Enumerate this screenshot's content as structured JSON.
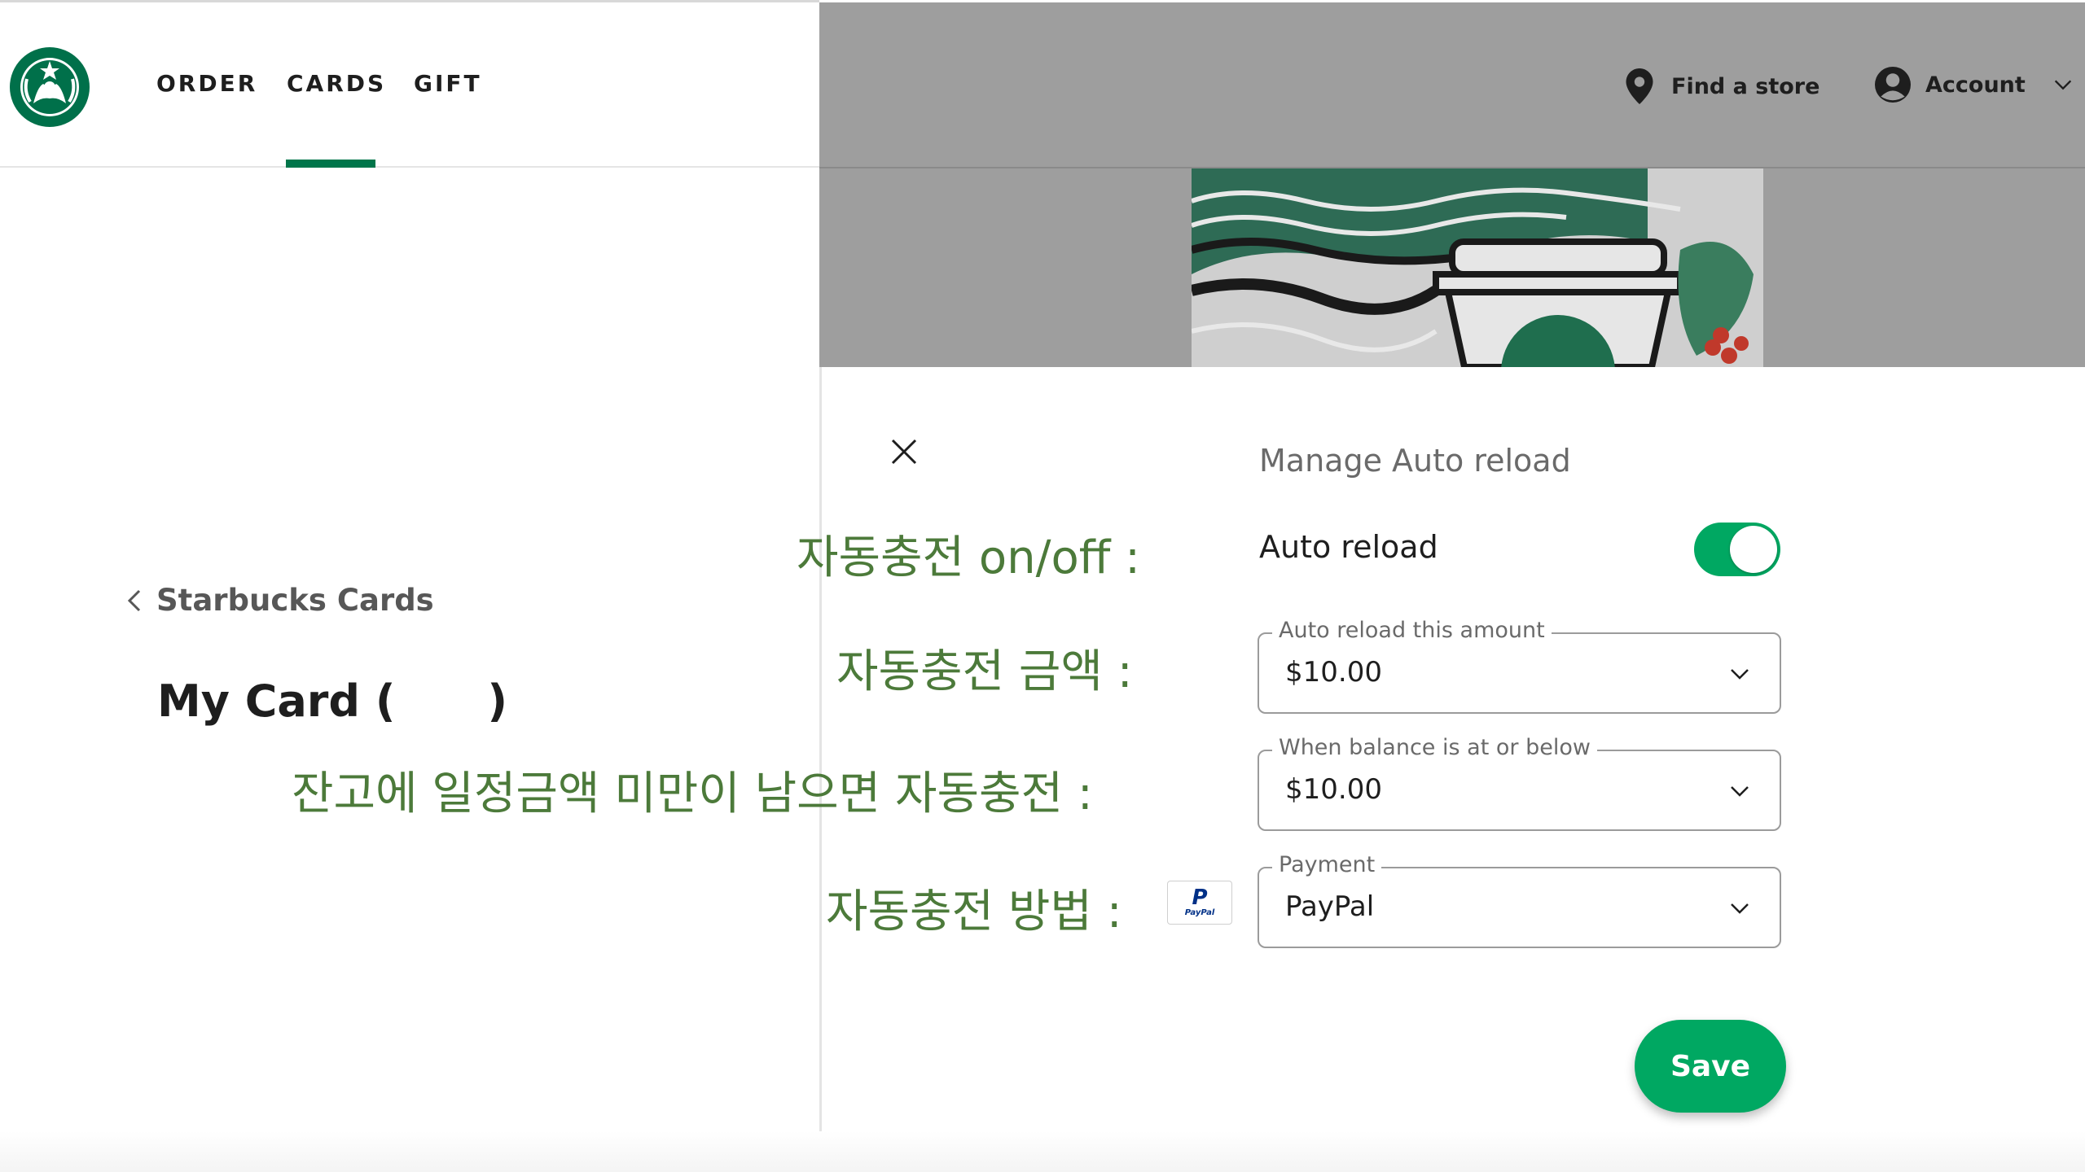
{
  "header": {
    "nav": [
      {
        "label": "ORDER"
      },
      {
        "label": "CARDS"
      },
      {
        "label": "GIFT"
      }
    ],
    "find_store": "Find a store",
    "account": "Account"
  },
  "left": {
    "back_link": "Starbucks Cards",
    "my_card": "My Card (      )"
  },
  "dialog": {
    "title": "Manage Auto reload",
    "auto_reload_label": "Auto reload",
    "auto_reload_on": true,
    "fields": [
      {
        "label": "Auto reload this amount",
        "value": "$10.00"
      },
      {
        "label": "When balance is at or below",
        "value": "$10.00"
      },
      {
        "label": "Payment",
        "value": "PayPal"
      }
    ],
    "save_label": "Save"
  },
  "annotations": {
    "toggle": "자동충전 on/off :",
    "amount": "자동충전 금액 :",
    "threshold": "잔고에 일정금액 미만이 남으면 자동충전 :",
    "method": "자동충전 방법 :"
  },
  "paypal_icon": {
    "letter": "P",
    "text": "PayPal"
  },
  "colors": {
    "brand_green": "#00a862",
    "dark_green": "#00754a",
    "overlay_gray": "#9e9e9e",
    "annotation_green": "#4c7a3a"
  }
}
